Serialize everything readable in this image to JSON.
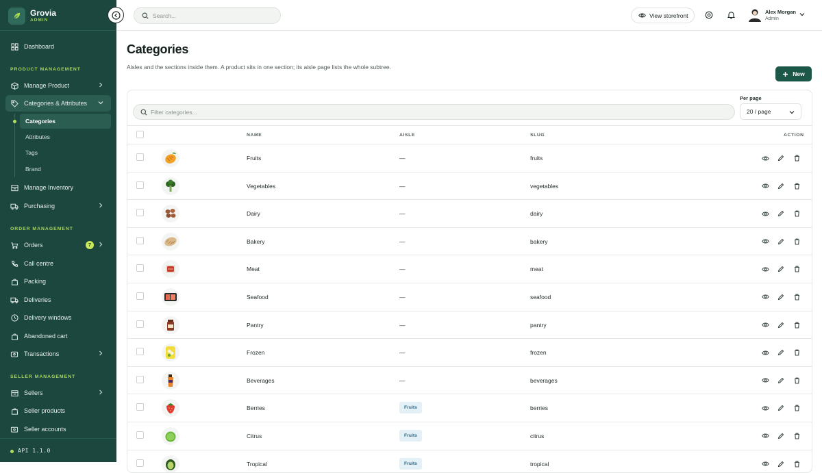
{
  "app": {
    "name": "Grovia",
    "subtitle": "ADMIN"
  },
  "sidebar": {
    "dashboard": "Dashboard",
    "sections": {
      "product": "PRODUCT MANAGEMENT",
      "order": "ORDER MANAGEMENT",
      "seller": "SELLER MANAGEMENT"
    },
    "product_items": {
      "manage_product": "Manage Product",
      "categories_attributes": "Categories & Attributes",
      "manage_inventory": "Manage Inventory",
      "purchasing": "Purchasing"
    },
    "sub_items": [
      "Categories",
      "Attributes",
      "Tags",
      "Brand"
    ],
    "order_items": {
      "orders": "Orders",
      "orders_count": "7",
      "call_centre": "Call centre",
      "packing": "Packing",
      "deliveries": "Deliveries",
      "delivery_windows": "Delivery windows",
      "abandoned_cart": "Abandoned cart",
      "transactions": "Transactions"
    },
    "seller_items": {
      "sellers": "Sellers",
      "seller_products": "Seller products",
      "seller_accounts": "Seller accounts"
    },
    "api_version": "API 1.1.0"
  },
  "topbar": {
    "search_placeholder": "Search...",
    "view_storefront": "View storefront",
    "user_name": "Alex Morgan",
    "user_role": "Admin"
  },
  "page": {
    "title": "Categories",
    "description": "Aisles and the sections inside them. A product sits in one section; its aisle page lists the whole subtree.",
    "new_button": "New",
    "filter_placeholder": "Filter categories...",
    "per_page_label": "Per page",
    "per_page_value": "20 / page"
  },
  "table": {
    "headers": {
      "name": "NAME",
      "aisle": "AISLE",
      "slug": "SLUG",
      "action": "ACTION"
    },
    "rows": [
      {
        "name": "Fruits",
        "aisle": "—",
        "slug": "fruits",
        "thumb": "mango-icon"
      },
      {
        "name": "Vegetables",
        "aisle": "—",
        "slug": "vegetables",
        "thumb": "broccoli-icon"
      },
      {
        "name": "Dairy",
        "aisle": "—",
        "slug": "dairy",
        "thumb": "eggs-icon"
      },
      {
        "name": "Bakery",
        "aisle": "—",
        "slug": "bakery",
        "thumb": "bread-icon"
      },
      {
        "name": "Meat",
        "aisle": "—",
        "slug": "meat",
        "thumb": "meat-icon"
      },
      {
        "name": "Seafood",
        "aisle": "—",
        "slug": "seafood",
        "thumb": "fish-icon"
      },
      {
        "name": "Pantry",
        "aisle": "—",
        "slug": "pantry",
        "thumb": "jar-icon"
      },
      {
        "name": "Frozen",
        "aisle": "—",
        "slug": "frozen",
        "thumb": "frozen-bag-icon"
      },
      {
        "name": "Beverages",
        "aisle": "—",
        "slug": "beverages",
        "thumb": "drink-icon"
      },
      {
        "name": "Berries",
        "aisle": "Fruits",
        "slug": "berries",
        "thumb": "strawberry-icon"
      },
      {
        "name": "Citrus",
        "aisle": "Fruits",
        "slug": "citrus",
        "thumb": "lime-icon"
      },
      {
        "name": "Tropical",
        "aisle": "Fruits",
        "slug": "tropical",
        "thumb": "avocado-icon"
      }
    ]
  },
  "colors": {
    "sidebar_bg": "#1c473e",
    "accent": "#1d5747",
    "lime": "#b6e05a",
    "chip_bg": "#e3f0f6",
    "chip_text": "#2a6a8a"
  }
}
